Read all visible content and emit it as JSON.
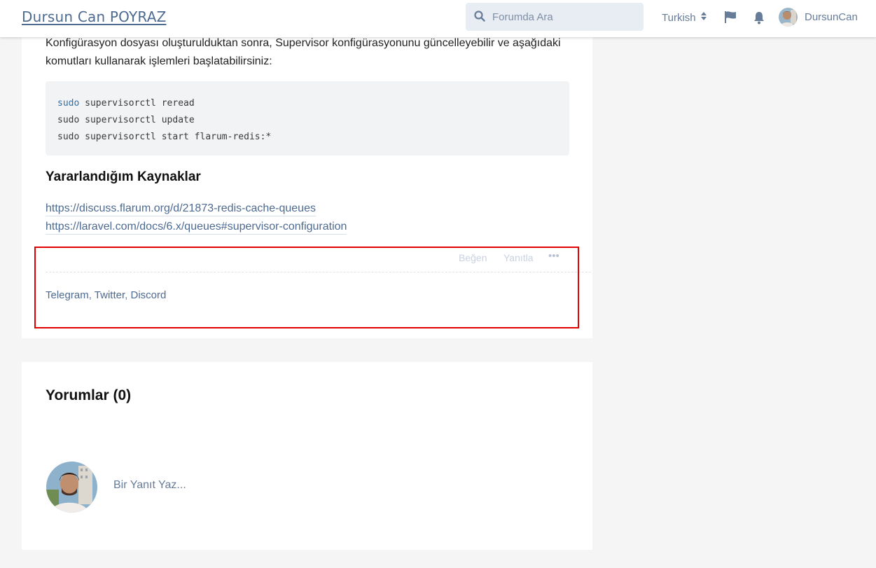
{
  "header": {
    "brand": "Dursun Can POYRAZ",
    "search_placeholder": "Forumda Ara",
    "language": "Turkish",
    "username": "DursunCan"
  },
  "post": {
    "paragraph": "Konfigürasyon dosyası oluşturulduktan sonra, Supervisor konfigürasyonunu güncelleyebilir ve aşağıdaki komutları kullanarak işlemleri başlatabilirsiniz:",
    "code_lines": [
      {
        "keyword": "sudo",
        "rest": " supervisorctl reread"
      },
      {
        "keyword": "sudo",
        "rest": " supervisorctl update"
      },
      {
        "keyword": "sudo",
        "rest": " supervisorctl start flarum-redis:*"
      }
    ],
    "sources_heading": "Yararlandığım Kaynaklar",
    "links": [
      "https://discuss.flarum.org/d/21873-redis-cache-queues",
      "https://laravel.com/docs/6.x/queues#supervisor-configuration"
    ],
    "actions": {
      "like": "Beğen",
      "reply": "Yanıtla",
      "more": "•••"
    },
    "social": {
      "telegram": "Telegram",
      "twitter": "Twitter",
      "discord": "Discord",
      "sep": ", "
    }
  },
  "comments": {
    "title": "Yorumlar (0)",
    "reply_placeholder": "Bir Yanıt Yaz..."
  },
  "colors": {
    "link": "#4d6a91",
    "highlight": "#e00000"
  }
}
